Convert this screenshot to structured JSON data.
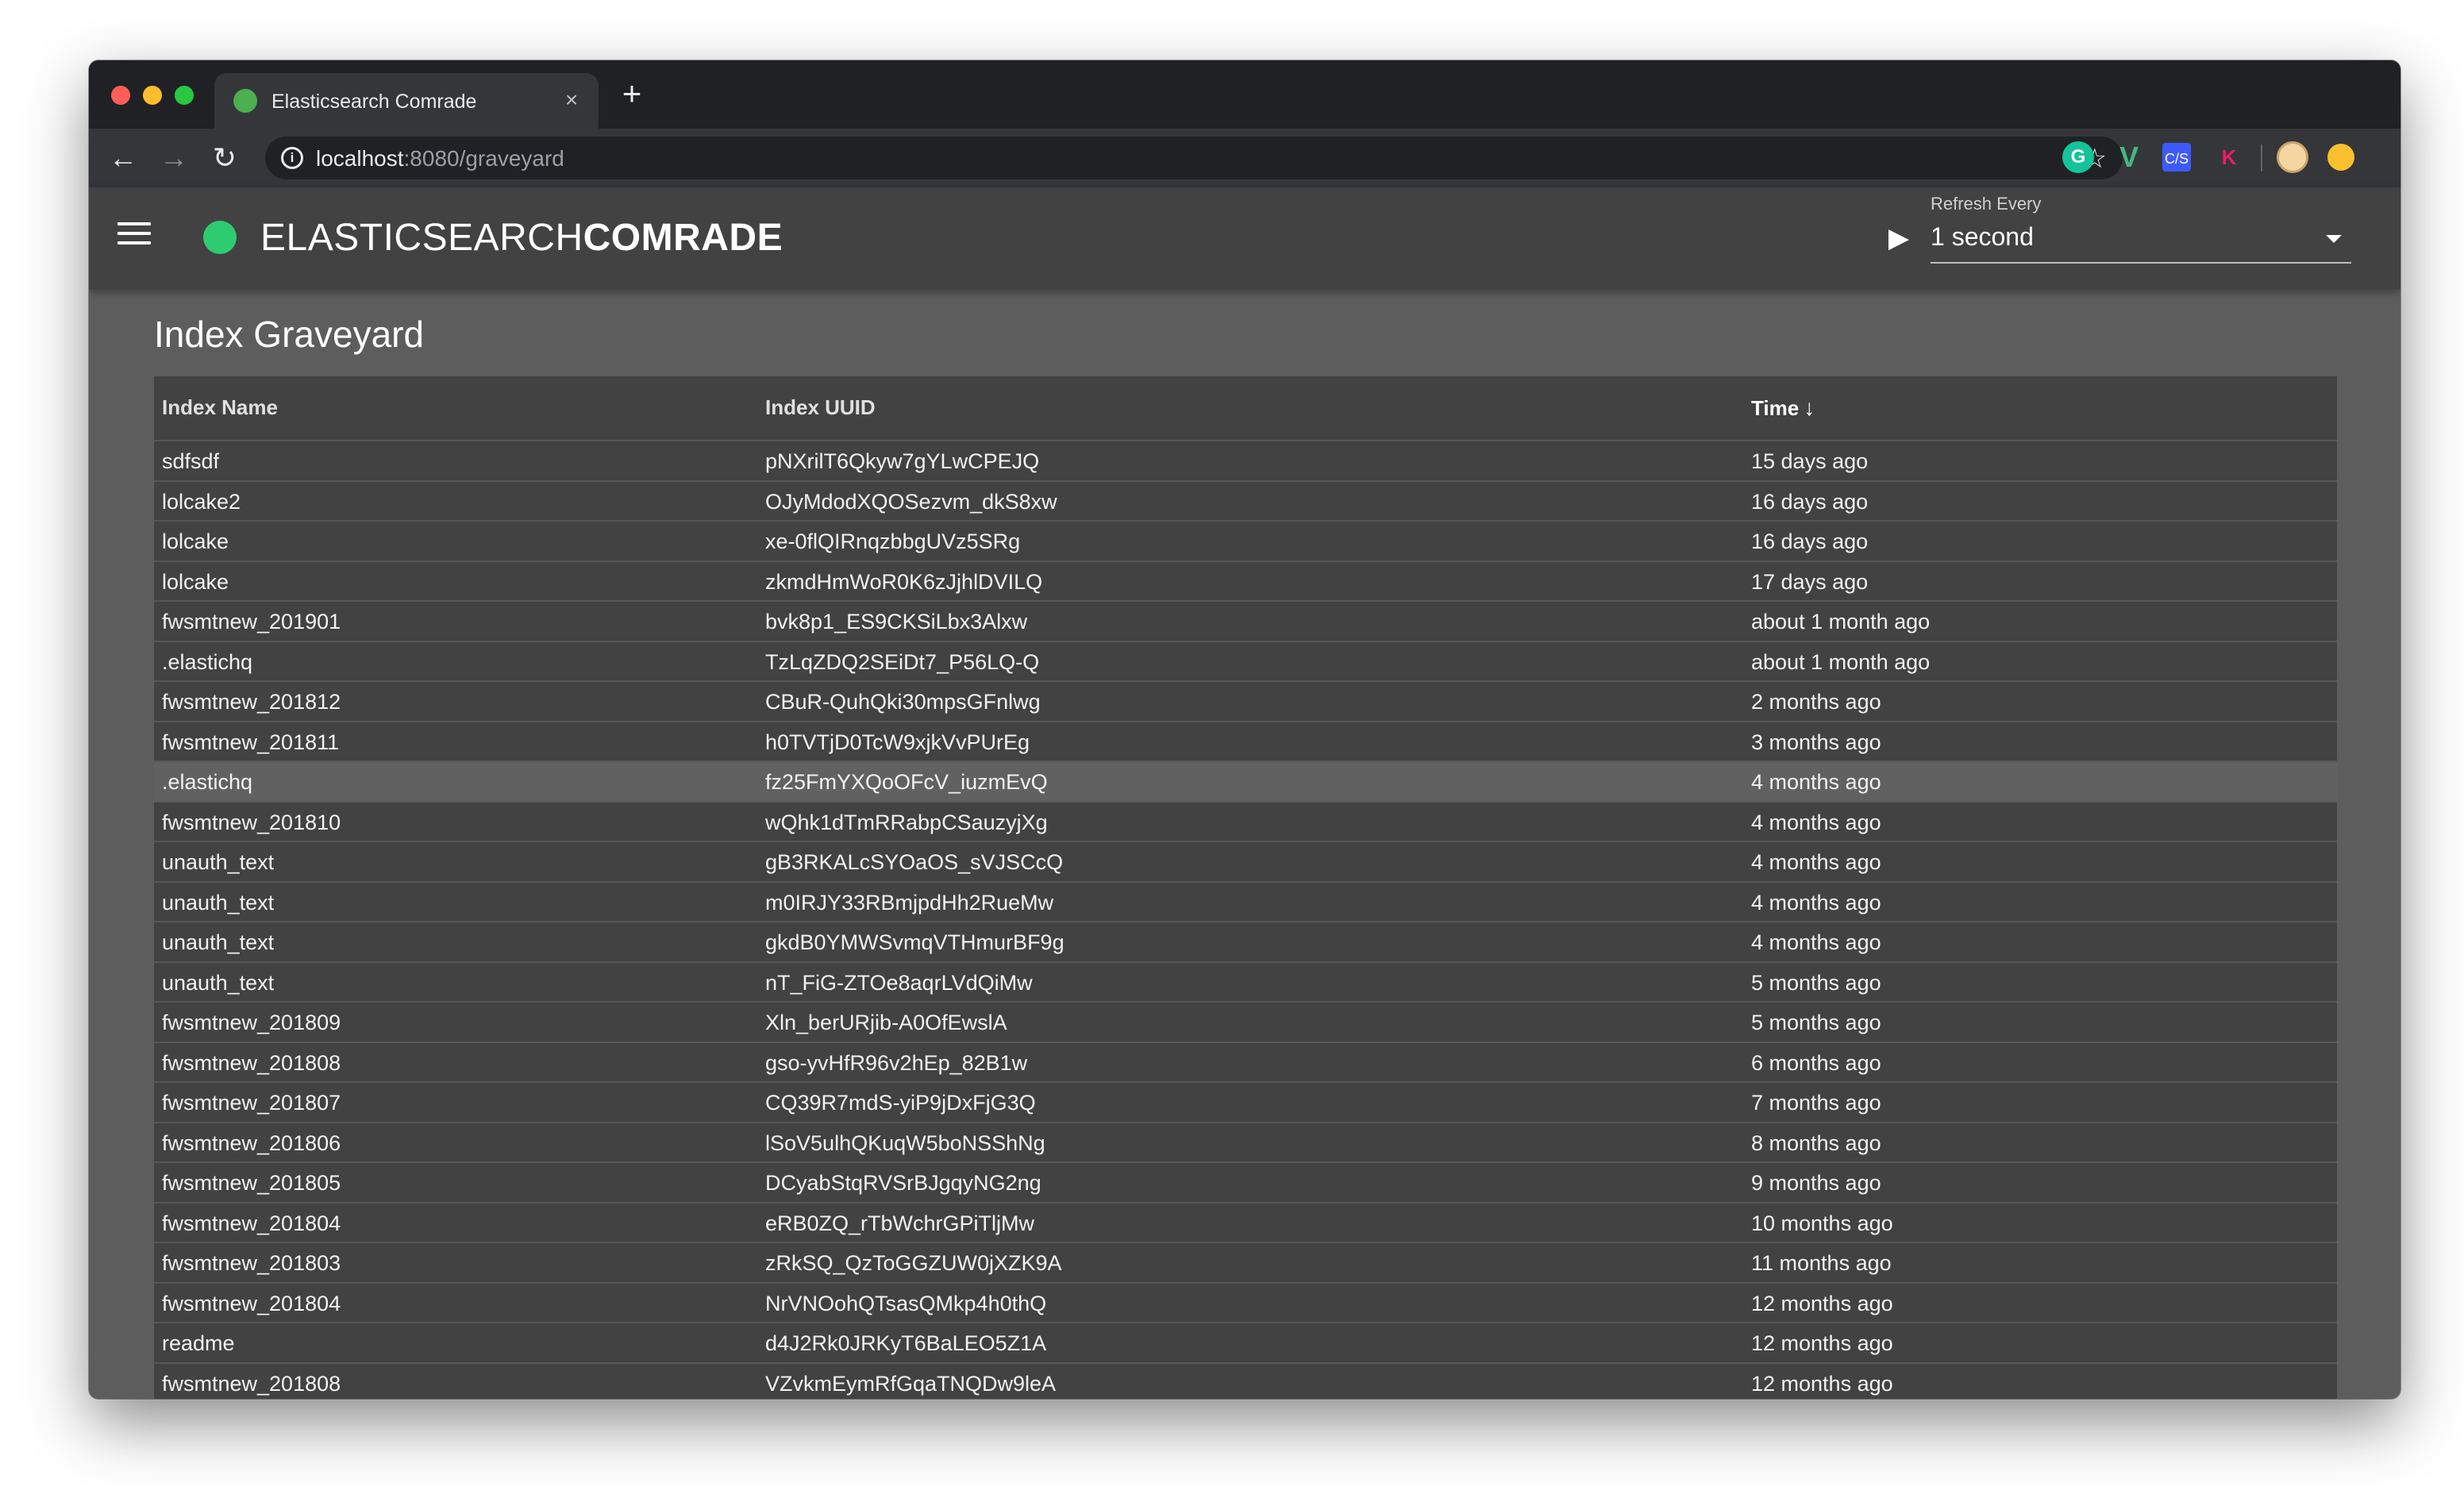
{
  "browser": {
    "tab_title": "Elasticsearch Comrade",
    "tab_close": "×",
    "new_tab": "+",
    "url_host": "localhost",
    "url_rest": ":8080/graveyard",
    "info_icon": "i"
  },
  "app": {
    "brand_light": "ELASTICSEARCH",
    "brand_bold": "COMRADE",
    "refresh_label": "Refresh Every",
    "refresh_value": "1 second",
    "status_color": "#2ecc71"
  },
  "page": {
    "title": "Index Graveyard"
  },
  "table": {
    "headers": {
      "name": "Index Name",
      "uuid": "Index UUID",
      "time": "Time"
    },
    "sort_arrow": "↓",
    "rows": [
      {
        "name": "sdfsdf",
        "uuid": "pNXrilT6Qkyw7gYLwCPEJQ",
        "time": "15 days ago"
      },
      {
        "name": "lolcake2",
        "uuid": "OJyMdodXQOSezvm_dkS8xw",
        "time": "16 days ago"
      },
      {
        "name": "lolcake",
        "uuid": "xe-0flQIRnqzbbgUVz5SRg",
        "time": "16 days ago"
      },
      {
        "name": "lolcake",
        "uuid": "zkmdHmWoR0K6zJjhlDVILQ",
        "time": "17 days ago"
      },
      {
        "name": "fwsmtnew_201901",
        "uuid": "bvk8p1_ES9CKSiLbx3Alxw",
        "time": "about 1 month ago"
      },
      {
        "name": ".elastichq",
        "uuid": "TzLqZDQ2SEiDt7_P56LQ-Q",
        "time": "about 1 month ago"
      },
      {
        "name": "fwsmtnew_201812",
        "uuid": "CBuR-QuhQki30mpsGFnlwg",
        "time": "2 months ago"
      },
      {
        "name": "fwsmtnew_201811",
        "uuid": "h0TVTjD0TcW9xjkVvPUrEg",
        "time": "3 months ago"
      },
      {
        "name": ".elastichq",
        "uuid": "fz25FmYXQoOFcV_iuzmEvQ",
        "time": "4 months ago"
      },
      {
        "name": "fwsmtnew_201810",
        "uuid": "wQhk1dTmRRabpCSauzyjXg",
        "time": "4 months ago"
      },
      {
        "name": "unauth_text",
        "uuid": "gB3RKALcSYOaOS_sVJSCcQ",
        "time": "4 months ago"
      },
      {
        "name": "unauth_text",
        "uuid": "m0IRJY33RBmjpdHh2RueMw",
        "time": "4 months ago"
      },
      {
        "name": "unauth_text",
        "uuid": "gkdB0YMWSvmqVTHmurBF9g",
        "time": "4 months ago"
      },
      {
        "name": "unauth_text",
        "uuid": "nT_FiG-ZTOe8aqrLVdQiMw",
        "time": "5 months ago"
      },
      {
        "name": "fwsmtnew_201809",
        "uuid": "Xln_berURjib-A0OfEwslA",
        "time": "5 months ago"
      },
      {
        "name": "fwsmtnew_201808",
        "uuid": "gso-yvHfR96v2hEp_82B1w",
        "time": "6 months ago"
      },
      {
        "name": "fwsmtnew_201807",
        "uuid": "CQ39R7mdS-yiP9jDxFjG3Q",
        "time": "7 months ago"
      },
      {
        "name": "fwsmtnew_201806",
        "uuid": "lSoV5ulhQKuqW5boNSShNg",
        "time": "8 months ago"
      },
      {
        "name": "fwsmtnew_201805",
        "uuid": "DCyabStqRVSrBJgqyNG2ng",
        "time": "9 months ago"
      },
      {
        "name": "fwsmtnew_201804",
        "uuid": "eRB0ZQ_rTbWchrGPiTljMw",
        "time": "10 months ago"
      },
      {
        "name": "fwsmtnew_201803",
        "uuid": "zRkSQ_QzToGGZUW0jXZK9A",
        "time": "11 months ago"
      },
      {
        "name": "fwsmtnew_201804",
        "uuid": "NrVNOohQTsasQMkp4h0thQ",
        "time": "12 months ago"
      },
      {
        "name": "readme",
        "uuid": "d4J2Rk0JRKyT6BaLEO5Z1A",
        "time": "12 months ago"
      },
      {
        "name": "fwsmtnew_201808",
        "uuid": "VZvkmEymRfGqaTNQDw9leA",
        "time": "12 months ago"
      }
    ]
  }
}
